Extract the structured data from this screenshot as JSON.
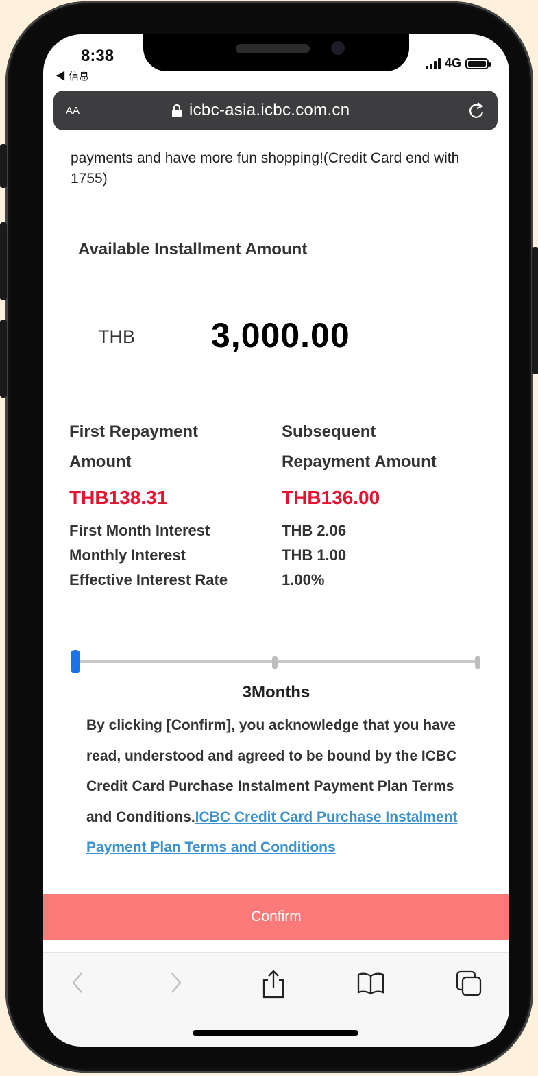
{
  "status_bar": {
    "time": "8:38",
    "back_label": "◀ 信息",
    "network": "4G"
  },
  "browser": {
    "aa_label": "AA",
    "url": "icbc-asia.icbc.com.cn"
  },
  "page": {
    "intro_text": "payments and have more fun shopping!(Credit Card end with 1755)",
    "available_title": "Available Installment Amount",
    "currency": "THB",
    "amount": "3,000.00",
    "first_repayment": {
      "heading_line1": "First Repayment",
      "heading_line2": "Amount",
      "amount": "THB138.31"
    },
    "subsequent_repayment": {
      "heading_line1": "Subsequent",
      "heading_line2": "Repayment Amount",
      "amount": "THB136.00"
    },
    "details": [
      {
        "label": "First Month Interest",
        "value": "THB 2.06"
      },
      {
        "label": "Monthly Interest",
        "value": "THB 1.00"
      },
      {
        "label": "Effective Interest Rate",
        "value": "1.00%"
      }
    ],
    "slider": {
      "selected_step": 0,
      "step_count": 3
    },
    "tenor_label": "3Months",
    "terms_text": "By clicking [Confirm], you acknowledge that you have read, understood and agreed to be bound by the ICBC Credit Card Purchase Instalment Payment Plan Terms and Conditions.",
    "terms_link": "ICBC Credit Card Purchase Instalment Payment Plan Terms and Conditions",
    "confirm_label": "Confirm"
  },
  "colors": {
    "accent_red": "#e8102e",
    "confirm_bg": "#fa7a7a",
    "link": "#3c91cf",
    "slider_knob": "#1a73e8"
  },
  "icons": {
    "back": "chevron-left-icon",
    "forward": "chevron-right-icon",
    "share": "share-icon",
    "bookmarks": "book-icon",
    "tabs": "tabs-icon"
  }
}
